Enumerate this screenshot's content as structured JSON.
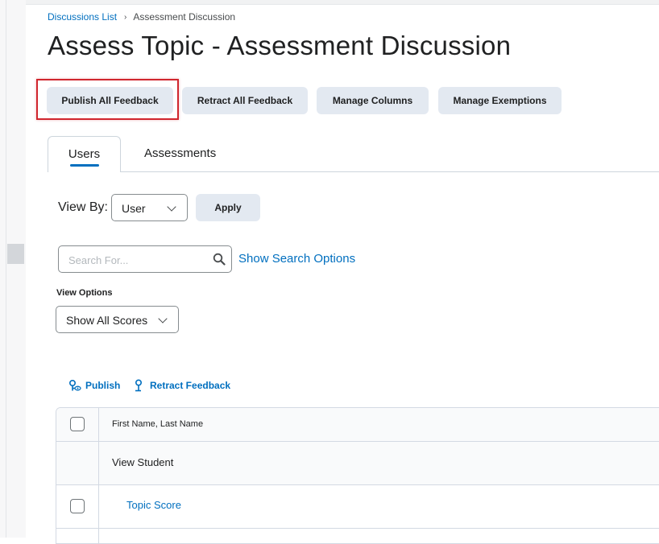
{
  "breadcrumb": {
    "parent": "Discussions List",
    "separator": "›",
    "current": "Assessment Discussion"
  },
  "page_title": "Assess Topic - Assessment Discussion",
  "toolbar": {
    "publish_all": "Publish All Feedback",
    "retract_all": "Retract All Feedback",
    "manage_columns": "Manage Columns",
    "manage_exemptions": "Manage Exemptions"
  },
  "tabs": [
    {
      "label": "Users",
      "active": true
    },
    {
      "label": "Assessments",
      "active": false
    }
  ],
  "view_by": {
    "label": "View By:",
    "selected": "User",
    "apply_label": "Apply"
  },
  "search": {
    "placeholder": "Search For...",
    "options_link": "Show Search Options"
  },
  "view_options": {
    "label": "View Options",
    "selected": "Show All Scores"
  },
  "actions": {
    "publish": "Publish",
    "retract": "Retract Feedback"
  },
  "table": {
    "header": "First Name, Last Name",
    "rows": [
      {
        "label": "View Student"
      },
      {
        "label": "Topic Score"
      }
    ]
  },
  "colors": {
    "accent": "#006fbf",
    "button_bg": "#e3e9f1",
    "highlight": "#d0262e"
  }
}
